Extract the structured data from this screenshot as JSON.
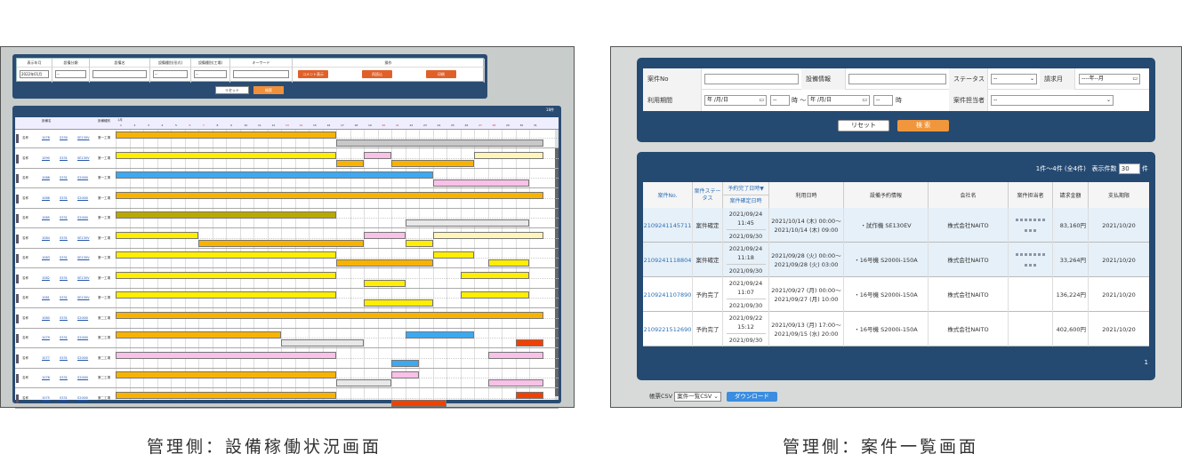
{
  "captions": {
    "left": "管理側：設備稼働状況画面",
    "right": "管理側：案件一覧画面"
  },
  "left": {
    "filter": {
      "headers": [
        "表示年月",
        "設備分類",
        "設備名",
        "設備種別(形式)",
        "設備種別(工場)",
        "キーワード",
        "操作"
      ],
      "month_value": "2022年01月",
      "dash_value": "--",
      "buttons": [
        "コメント表示",
        "再読込",
        "印刷"
      ],
      "reset": "リセット",
      "search": "検索"
    },
    "count": "18件",
    "columns": {
      "equipment": "設備名",
      "type": "設備種別",
      "month": "1月"
    },
    "days": [
      "1",
      "2",
      "3",
      "4",
      "5",
      "6",
      "7",
      "8",
      "9",
      "10",
      "11",
      "12",
      "13",
      "14",
      "15",
      "16",
      "17",
      "18",
      "19",
      "20",
      "21",
      "22",
      "23",
      "24",
      "25",
      "26",
      "27",
      "28",
      "29",
      "30",
      "31"
    ],
    "rows": [
      {
        "name": "名称",
        "id": "1078",
        "model": "S330",
        "code": "SE130V",
        "type": "第一工場",
        "bars": [
          {
            "s": 0,
            "e": 16,
            "c": "#f8b300"
          },
          {
            "s": 16,
            "e": 31,
            "c": "#c8c8c8"
          }
        ]
      },
      {
        "name": "名称",
        "id": "1090",
        "model": "S331",
        "code": "SE130V",
        "type": "第一工場",
        "bars": [
          {
            "s": 0,
            "e": 16,
            "c": "#ffee00"
          },
          {
            "s": 16,
            "e": 18,
            "c": "#f8b300"
          },
          {
            "s": 18,
            "e": 20,
            "c": "#f9c0e8"
          },
          {
            "s": 20,
            "e": 26,
            "c": "#f8b300"
          },
          {
            "s": 26,
            "e": 31,
            "c": "#fff5b8"
          }
        ]
      },
      {
        "name": "名称",
        "id": "1088",
        "model": "S331",
        "code": "S2000i",
        "type": "第一工場",
        "bars": [
          {
            "s": 0,
            "e": 23,
            "c": "#3da9f0"
          },
          {
            "s": 23,
            "e": 30,
            "c": "#f9c0e8"
          }
        ]
      },
      {
        "name": "名称",
        "id": "1086",
        "model": "S331",
        "code": "S2000i",
        "type": "第一工場",
        "bars": [
          {
            "s": 0,
            "e": 31,
            "c": "#f8b300"
          }
        ]
      },
      {
        "name": "名称",
        "id": "1085",
        "model": "S331",
        "code": "S2000i",
        "type": "第一工場",
        "bars": [
          {
            "s": 0,
            "e": 16,
            "c": "#b8a800"
          },
          {
            "s": 21,
            "e": 30,
            "c": "#e8e8e8"
          }
        ]
      },
      {
        "name": "名称",
        "id": "1084",
        "model": "S331",
        "code": "SE130V",
        "type": "第一工場",
        "bars": [
          {
            "s": 0,
            "e": 6,
            "c": "#ffee00"
          },
          {
            "s": 6,
            "e": 18,
            "c": "#f8b300"
          },
          {
            "s": 18,
            "e": 21,
            "c": "#f9c0e8"
          },
          {
            "s": 21,
            "e": 23,
            "c": "#ffee00"
          },
          {
            "s": 23,
            "e": 31,
            "c": "#fff5b8"
          }
        ]
      },
      {
        "name": "名称",
        "id": "1083",
        "model": "S331",
        "code": "SE130V",
        "type": "第一工場",
        "bars": [
          {
            "s": 0,
            "e": 16,
            "c": "#ffee00"
          },
          {
            "s": 16,
            "e": 23,
            "c": "#f8b300"
          },
          {
            "s": 23,
            "e": 26,
            "c": "#ffee00"
          },
          {
            "s": 27,
            "e": 30,
            "c": "#ffee00"
          }
        ]
      },
      {
        "name": "名称",
        "id": "1082",
        "model": "S331",
        "code": "SE130V",
        "type": "第一工場",
        "bars": [
          {
            "s": 0,
            "e": 16,
            "c": "#ffee00"
          },
          {
            "s": 18,
            "e": 21,
            "c": "#ffee00"
          },
          {
            "s": 25,
            "e": 30,
            "c": "#ffee00"
          }
        ]
      },
      {
        "name": "名称",
        "id": "1081",
        "model": "S331",
        "code": "SE130V",
        "type": "第一工場",
        "bars": [
          {
            "s": 0,
            "e": 16,
            "c": "#ffee00"
          },
          {
            "s": 18,
            "e": 23,
            "c": "#ffee00"
          },
          {
            "s": 25,
            "e": 30,
            "c": "#ffee00"
          }
        ]
      },
      {
        "name": "名称",
        "id": "1080",
        "model": "S331",
        "code": "S2000i",
        "type": "第二工場",
        "bars": [
          {
            "s": 0,
            "e": 31,
            "c": "#f8b300"
          }
        ]
      },
      {
        "name": "名称",
        "id": "1079",
        "model": "S331",
        "code": "S2000i",
        "type": "第二工場",
        "bars": [
          {
            "s": 0,
            "e": 12,
            "c": "#f8b300"
          },
          {
            "s": 12,
            "e": 18,
            "c": "#e8e8e8"
          },
          {
            "s": 21,
            "e": 26,
            "c": "#3da9f0"
          },
          {
            "s": 29,
            "e": 31,
            "c": "#f24000"
          }
        ]
      },
      {
        "name": "名称",
        "id": "1077",
        "model": "S331",
        "code": "S2000i",
        "type": "第二工場",
        "bars": [
          {
            "s": 0,
            "e": 16,
            "c": "#f9c0e8"
          },
          {
            "s": 20,
            "e": 22,
            "c": "#3da9f0"
          },
          {
            "s": 27,
            "e": 31,
            "c": "#f9c0e8"
          }
        ]
      },
      {
        "name": "名称",
        "id": "1076",
        "model": "S331",
        "code": "S2000i",
        "type": "第二工場",
        "bars": [
          {
            "s": 0,
            "e": 16,
            "c": "#f8b300"
          },
          {
            "s": 16,
            "e": 20,
            "c": "#e8e8e8"
          },
          {
            "s": 20,
            "e": 22,
            "c": "#f9c0e8"
          },
          {
            "s": 27,
            "e": 31,
            "c": "#f9c0e8"
          }
        ]
      },
      {
        "name": "名称",
        "id": "1075",
        "model": "S331",
        "code": "S2000i",
        "type": "第二工場",
        "bars": [
          {
            "s": 0,
            "e": 16,
            "c": "#f8b300"
          },
          {
            "s": 20,
            "e": 24,
            "c": "#f24000"
          },
          {
            "s": 29,
            "e": 31,
            "c": "#f24000"
          }
        ]
      }
    ]
  },
  "right": {
    "filter": {
      "case_no_label": "案件No",
      "equipment_label": "設備情報",
      "status_label": "ステータス",
      "status_value": "--",
      "billing_label": "請求月",
      "billing_value": "----年--月",
      "period_label": "利用期間",
      "date_placeholder": "年 /月/日",
      "hour_value": "--",
      "hour_suffix": "時",
      "range_sep": "時 ～",
      "owner_label": "案件担当者",
      "owner_value": "--",
      "reset": "リセット",
      "search": "検 索"
    },
    "meta": {
      "count": "1件～4件 (全4件)",
      "per_page_label": "表示件数",
      "per_page": "30",
      "unit": "件"
    },
    "headers": {
      "case_no": "案件No.",
      "status": "案件ステータス",
      "reserve_date": "予約完了日時▼",
      "confirm_date": "案件確定日時",
      "use_date": "利用日時",
      "equipment": "設備予約情報",
      "company": "会社名",
      "owner": "案件担当者",
      "amount": "請求金額",
      "payment": "支払期限"
    },
    "rows": [
      {
        "case_no": "2109241145711",
        "status": "案件確定",
        "reserved": "2021/09/24 11:45",
        "confirmed": "2021/09/30",
        "use_from": "2021/10/14 (木) 00:00～",
        "use_to": "2021/10/14 (木) 09:00",
        "equipment": "・試作機 SE130EV",
        "company": "株式会社NAITO",
        "amount": "83,160円",
        "payment": "2021/10/20",
        "owner_blurred": true
      },
      {
        "case_no": "2109241118804",
        "status": "案件確定",
        "reserved": "2021/09/24 11:18",
        "confirmed": "2021/09/30",
        "use_from": "2021/09/28 (火) 00:00～",
        "use_to": "2021/09/28 (火) 03:00",
        "equipment": "・16号機 S2000i-150A",
        "company": "株式会社NAITO",
        "amount": "33,264円",
        "payment": "2021/10/20",
        "owner_blurred": true
      },
      {
        "case_no": "2109241107890",
        "status": "予約完了",
        "reserved": "2021/09/24 11:07",
        "confirmed": "2021/09/30",
        "use_from": "2021/09/27 (月) 00:00～",
        "use_to": "2021/09/27 (月) 10:00",
        "equipment": "・16号機 S2000i-150A",
        "company": "株式会社NAITO",
        "amount": "136,224円",
        "payment": "2021/10/20",
        "owner_blurred": false
      },
      {
        "case_no": "2109221512690",
        "status": "予約完了",
        "reserved": "2021/09/22 15:12",
        "confirmed": "2021/09/30",
        "use_from": "2021/09/13 (月) 17:00～",
        "use_to": "2021/09/15 (水) 20:00",
        "equipment": "・16号機 S2000i-150A",
        "company": "株式会社NAITO",
        "amount": "402,600円",
        "payment": "2021/10/20",
        "owner_blurred": false
      }
    ],
    "page": "1",
    "csv": {
      "label": "帳票CSV",
      "select": "案件一覧CSV",
      "download": "ダウンロード"
    },
    "colors": {
      "navy": "#254a72",
      "orange": "#f0963c",
      "link": "#2c6fb8",
      "highlight": "#e6f0f8"
    }
  }
}
